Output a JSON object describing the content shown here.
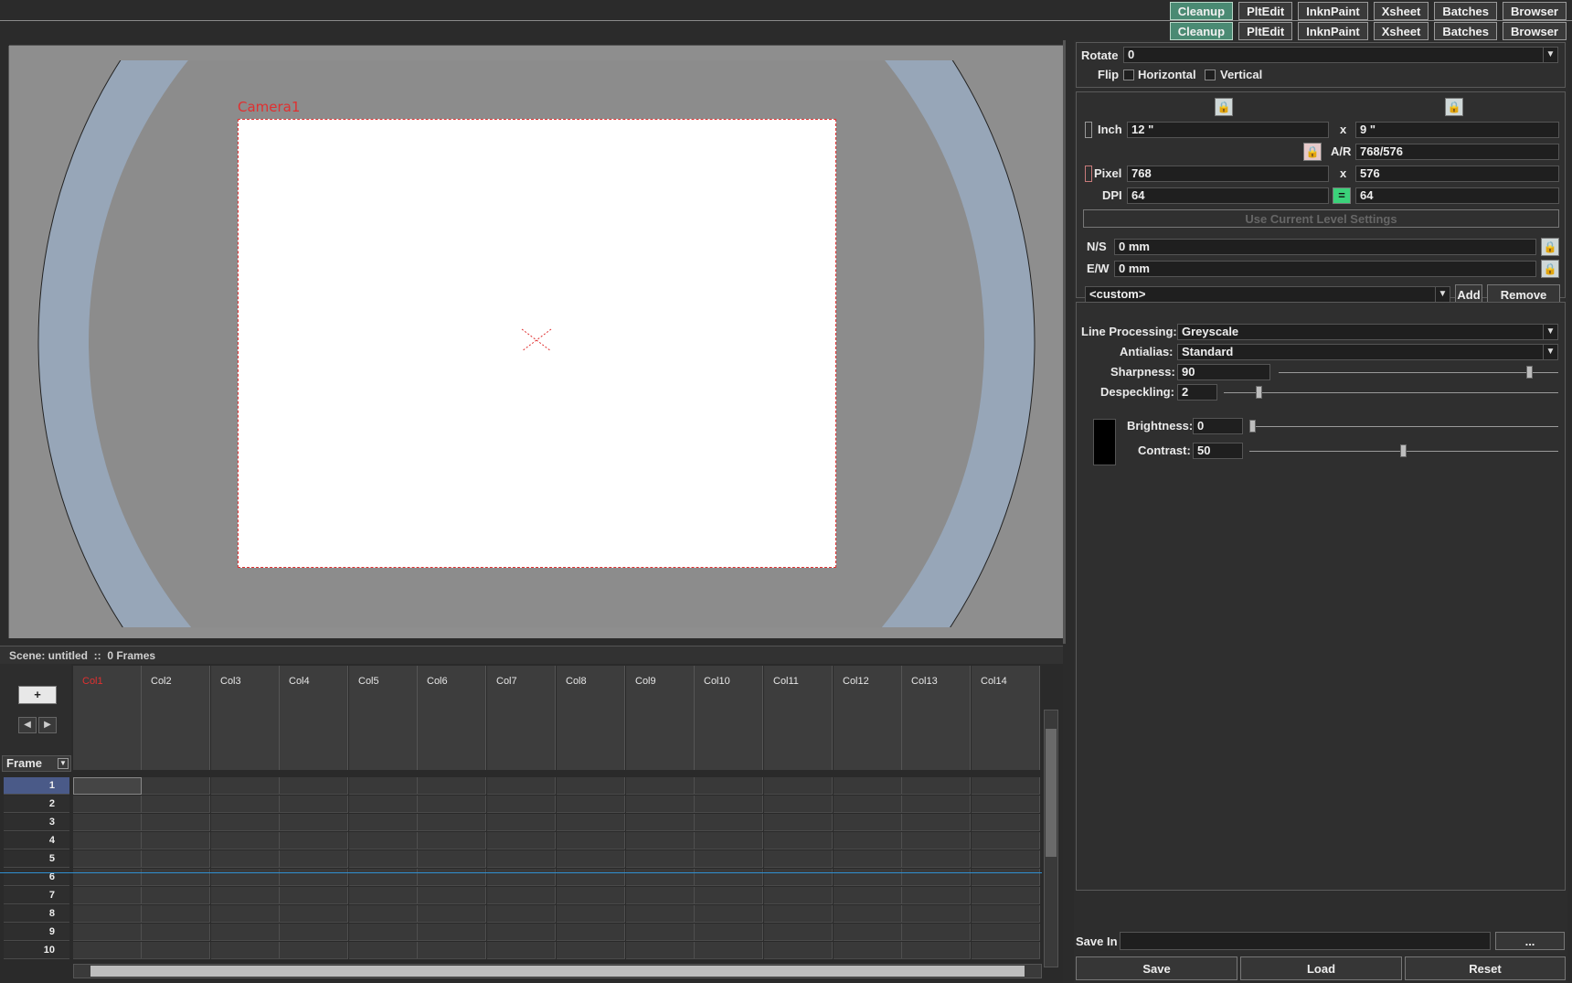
{
  "rooms": [
    "Cleanup",
    "PltEdit",
    "InknPaint",
    "Xsheet",
    "Batches",
    "Browser"
  ],
  "active_room": "Cleanup",
  "viewer": {
    "camera_label": "Camera1"
  },
  "transform": {
    "rotate_label": "Rotate",
    "rotate_value": "0",
    "flip_label": "Flip",
    "horizontal_label": "Horizontal",
    "vertical_label": "Vertical"
  },
  "camera": {
    "inch_label": "Inch",
    "inch_w": "12 \"",
    "inch_h": "9 \"",
    "x1": "x",
    "x2": "x",
    "ar_label": "A/R",
    "ar_value": "768/576",
    "pixel_label": "Pixel",
    "pixel_w": "768",
    "pixel_h": "576",
    "dpi_label": "DPI",
    "dpi_w": "64",
    "dpi_h": "64",
    "use_current_label": "Use Current Level Settings",
    "ns_label": "N/S",
    "ns_value": "0 mm",
    "ew_label": "E/W",
    "ew_value": "0 mm",
    "preset_value": "<custom>",
    "add_label": "Add",
    "remove_label": "Remove"
  },
  "cleanup": {
    "line_processing_label": "Line Processing:",
    "line_processing_value": "Greyscale",
    "antialias_label": "Antialias:",
    "antialias_value": "Standard",
    "sharpness_label": "Sharpness:",
    "sharpness_value": "90",
    "despeckling_label": "Despeckling:",
    "despeckling_value": "2",
    "brightness_label": "Brightness:",
    "brightness_value": "0",
    "contrast_label": "Contrast:",
    "contrast_value": "50",
    "swatch_color": "#000000"
  },
  "output": {
    "save_in_label": "Save In",
    "save_in_value": "",
    "browse_label": "...",
    "save_label": "Save",
    "load_label": "Load",
    "reset_label": "Reset"
  },
  "scene": {
    "name_label": "Scene: untitled  ::  0 Frames"
  },
  "xsheet": {
    "frame_header": "Frame",
    "columns": [
      "Col1",
      "Col2",
      "Col3",
      "Col4",
      "Col5",
      "Col6",
      "Col7",
      "Col8",
      "Col9",
      "Col10",
      "Col11",
      "Col12",
      "Col13",
      "Col14"
    ],
    "frames": [
      "1",
      "2",
      "3",
      "4",
      "5",
      "6",
      "7",
      "8",
      "9",
      "10"
    ]
  },
  "colors": {
    "accent": "#4a8a73",
    "camera_red": "#e03030",
    "selected_frame": "#4a5a88"
  }
}
